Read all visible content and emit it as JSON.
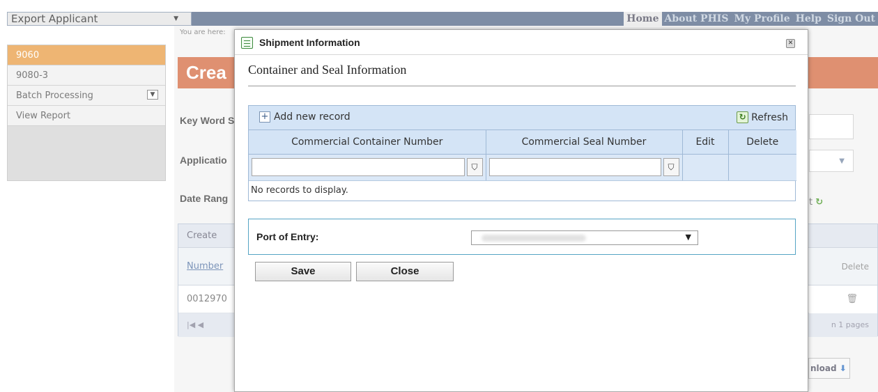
{
  "app": {
    "role_select": "Export Applicant",
    "nav": [
      "Home",
      "About PHIS",
      "My Profile",
      "Help",
      "Sign Out"
    ],
    "active_nav": "Home"
  },
  "sidebar": {
    "items": [
      {
        "label": "9060",
        "active": true
      },
      {
        "label": "9080-3",
        "active": false
      },
      {
        "label": "Batch Processing",
        "active": false,
        "dropdown": true
      },
      {
        "label": "View Report",
        "active": false
      }
    ]
  },
  "background_page": {
    "breadcrumb": "You are here:",
    "title_fragment": "Crea",
    "keyword_label": "Key Word S",
    "application_label": "Applicatio",
    "date_range_label": "Date Rang",
    "grid_toolbar": "Create",
    "grid_header_number": "Number",
    "grid_header_delete": "Delete",
    "grid_row_number": "0012970",
    "pager_text": "n 1 pages",
    "reset_fragment": "t",
    "download_fragment": "nload"
  },
  "modal": {
    "title": "Shipment Information",
    "section_title": "Container and Seal Information",
    "grid": {
      "add_label": "Add new record",
      "refresh_label": "Refresh",
      "columns": [
        "Commercial Container Number",
        "Commercial Seal Number",
        "Edit",
        "Delete"
      ],
      "empty_text": "No records to display."
    },
    "port_of_entry_label": "Port of Entry:",
    "save_label": "Save",
    "close_label": "Close"
  },
  "colors": {
    "accent_orange": "#e9a14c",
    "title_band": "#d6714a",
    "grid_header": "#d4e4f6",
    "topbar": "#5a6e8c"
  }
}
